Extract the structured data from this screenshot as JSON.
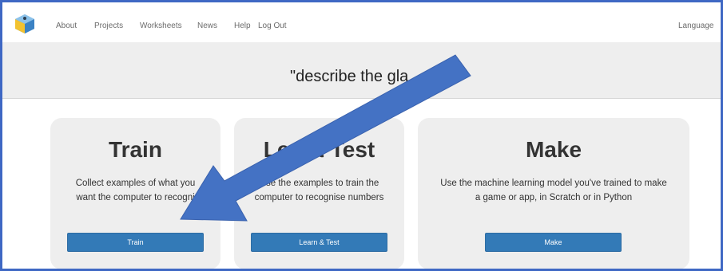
{
  "nav": {
    "links": [
      "About",
      "Projects",
      "Worksheets",
      "News",
      "Help",
      "Log Out"
    ],
    "language": "Language"
  },
  "banner": {
    "text": "\"describe the gla"
  },
  "cards": [
    {
      "title": "Train",
      "description_lines": [
        "Collect examples of what you",
        "want the computer to recogni"
      ],
      "button": "Train"
    },
    {
      "title": "Lea  & Test",
      "description_lines": [
        "Use the examples to train the",
        "computer to recognise numbers"
      ],
      "button": "Learn & Test"
    },
    {
      "title": "Make",
      "description_lines": [
        "Use the machine learning model you've trained to make",
        "a game or app, in Scratch or in Python"
      ],
      "button": "Make"
    }
  ],
  "colors": {
    "frame_border": "#3f68c4",
    "button": "#337ab7",
    "annotation_arrow": "#4472c4"
  }
}
